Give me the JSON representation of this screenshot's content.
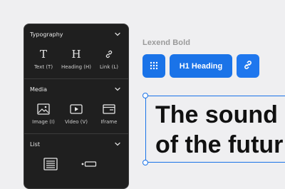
{
  "panel": {
    "typography": {
      "title": "Typography",
      "items": [
        {
          "label": "Text (T)",
          "icon": "text-icon"
        },
        {
          "label": "Heading (H)",
          "icon": "heading-icon"
        },
        {
          "label": "Link (L)",
          "icon": "link-icon"
        }
      ]
    },
    "media": {
      "title": "Media",
      "items": [
        {
          "label": "Image (I)",
          "icon": "image-icon"
        },
        {
          "label": "Video (V)",
          "icon": "video-icon"
        },
        {
          "label": "Iframe",
          "icon": "iframe-icon"
        }
      ]
    },
    "list": {
      "title": "List",
      "items": [
        {
          "icon": "list-icon"
        },
        {
          "icon": "list-item-icon"
        }
      ]
    }
  },
  "toolbar": {
    "font_label": "Lexend Bold",
    "heading_label": "H1 Heading",
    "accent": "#1a73e8"
  },
  "canvas": {
    "line1": "The sound",
    "line2": "of the futur"
  }
}
